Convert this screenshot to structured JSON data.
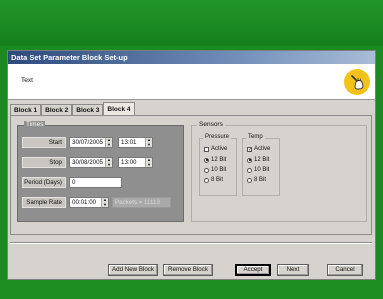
{
  "window": {
    "title": "Data Set Parameter Block Set-up"
  },
  "header": {
    "text": "Text"
  },
  "tabs": [
    {
      "label": "Block 1"
    },
    {
      "label": "Block 2"
    },
    {
      "label": "Block 3"
    },
    {
      "label": "Block 4"
    }
  ],
  "times": {
    "title": "Times",
    "start": {
      "label": "Start",
      "date": "30/07/2005",
      "time": "13:01"
    },
    "stop": {
      "label": "Stop",
      "date": "30/08/2005",
      "time": "13:00"
    },
    "period": {
      "label": "Period (Days)",
      "value": "0"
    },
    "sample_rate": {
      "label": "Sample Rate",
      "value": "00:01:00",
      "packets": "Packets = 11113"
    }
  },
  "sensors": {
    "title": "Sensors",
    "pressure": {
      "title": "Pressure",
      "active_label": "Active",
      "active_checked": false,
      "options": [
        "12 Bit",
        "10 Bit",
        "8 Bit"
      ],
      "selected": "12 Bit"
    },
    "temp": {
      "title": "Temp",
      "active_label": "Active",
      "active_checked": true,
      "options": [
        "12 Bit",
        "10 Bit",
        "8 Bit"
      ],
      "selected": "12 Bit"
    }
  },
  "buttons": {
    "add_new_block": "Add New Block",
    "remove_block": "Remove Block",
    "accept": "Accept",
    "next": "Next",
    "cancel": "Cancel"
  },
  "colors": {
    "background_green": "#1b8a20",
    "title_bar": "#2c4a7c",
    "icon_yellow": "#f3c21b"
  }
}
